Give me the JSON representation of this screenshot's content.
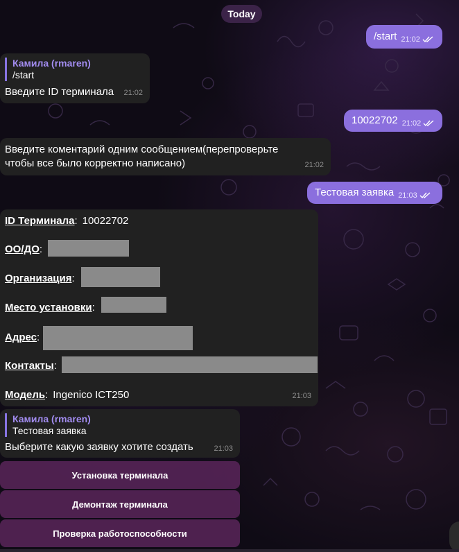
{
  "date_separator": "Today",
  "messages": {
    "m1": {
      "text": "/start",
      "time": "21:02"
    },
    "m2": {
      "reply_name": "Камила (rmaren)",
      "reply_text": "/start",
      "text": "Введите ID терминала",
      "time": "21:02"
    },
    "m3": {
      "text": "10022702",
      "time": "21:02"
    },
    "m4": {
      "line1": "Введите коментарий одним сообщением(перепроверьте",
      "line2": "чтобы все было корректно написано)",
      "time": "21:02"
    },
    "m5": {
      "text": "Тестовая заявка",
      "time": "21:03"
    },
    "m6": {
      "fields": [
        {
          "label": "ID Терминала",
          "sep": ":",
          "value": "10022702"
        },
        {
          "label": "ОО/ДО",
          "sep": ":",
          "value": "",
          "redacted": true
        },
        {
          "label": "Организация",
          "sep": ":",
          "value": "",
          "redacted": true
        },
        {
          "label": "Место установки",
          "sep": ":",
          "value": "",
          "redacted": true
        },
        {
          "label": "Адрес",
          "sep": ":",
          "value": "",
          "redacted": true
        },
        {
          "label": "Контакты",
          "sep": ":",
          "value": "",
          "redacted": true
        },
        {
          "label": "Модель",
          "sep": ":",
          "value": "Ingenico ICT250"
        }
      ],
      "time": "21:03"
    },
    "m7": {
      "reply_name": "Камила (rmaren)",
      "reply_text": "Тестовая заявка",
      "text": "Выберите какую заявку хотите создать",
      "time": "21:03"
    }
  },
  "keyboard": [
    {
      "label": "Установка терминала"
    },
    {
      "label": "Демонтаж терминала"
    },
    {
      "label": "Проверка работоспособности"
    }
  ],
  "colors": {
    "outgoing_bubble": "#8b6fde",
    "incoming_bubble": "#212121",
    "reply_accent": "#8774e1",
    "keyboard_button": "#602860",
    "redaction": "#8a8a8a"
  },
  "icons": [
    "double-check-icon",
    "scroll-down-button"
  ]
}
